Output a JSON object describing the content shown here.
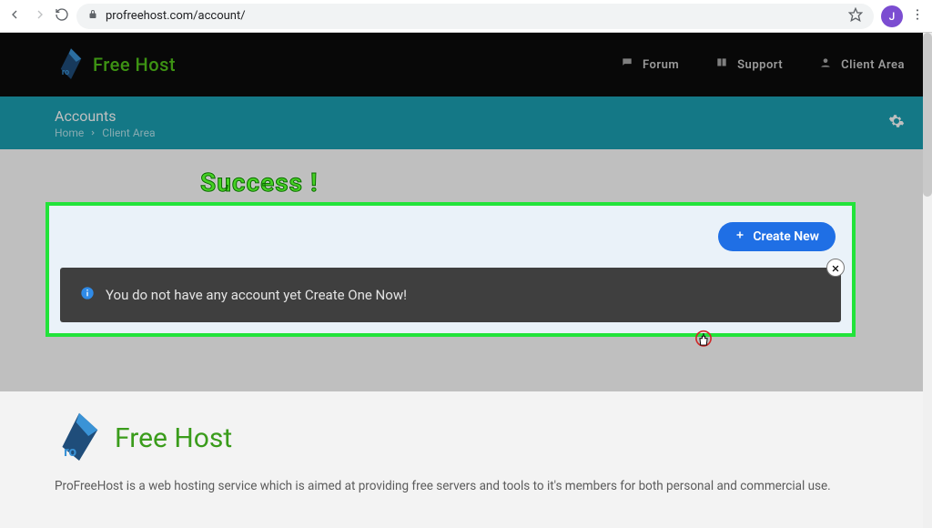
{
  "browser": {
    "url": "profreehost.com/account/",
    "avatar_initial": "J"
  },
  "header": {
    "brand": "Free Host",
    "nav": [
      {
        "label": "Forum"
      },
      {
        "label": "Support"
      },
      {
        "label": "Client Area"
      }
    ]
  },
  "pagebar": {
    "title": "Accounts",
    "breadcrumb": {
      "home": "Home",
      "current": "Client Area"
    }
  },
  "annotation": {
    "success": "Success !"
  },
  "card": {
    "create_label": "Create New",
    "notice": "You do not have any account yet Create One Now!"
  },
  "footer": {
    "brand": "Free Host",
    "desc": "ProFreeHost is a web hosting service which is aimed at providing free servers and tools to it's members for both personal and commercial use."
  }
}
